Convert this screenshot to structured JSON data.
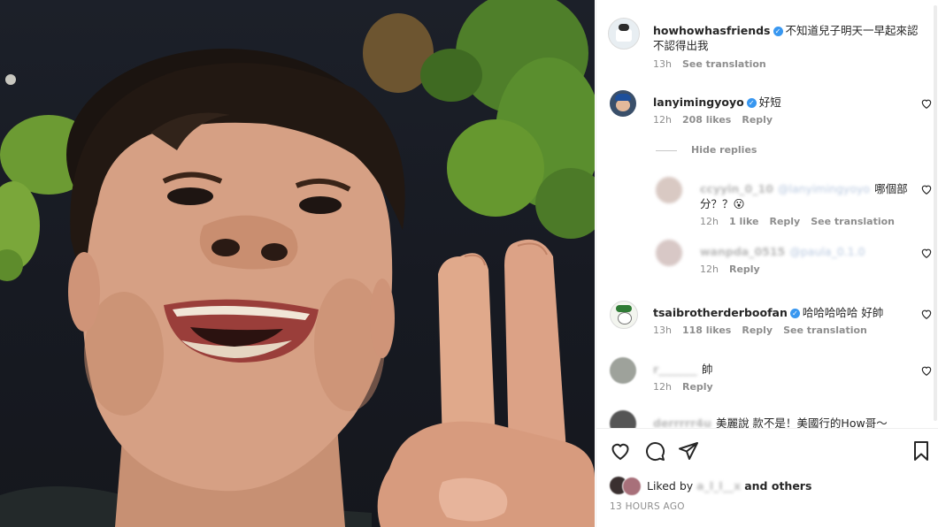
{
  "post": {
    "author": "howhowhasfriends",
    "caption_line1": "不知道兒子明天一早起來認",
    "caption_line2": "不認得出我",
    "time": "13h",
    "see_translation": "See translation"
  },
  "comments": [
    {
      "user": "lanyimingyoyo",
      "verified": true,
      "text": "好短",
      "time": "12h",
      "likes": "208 likes",
      "reply": "Reply"
    },
    {
      "user": "tsaibrotherderboofan",
      "verified": true,
      "text": "哈哈哈哈哈 好帥",
      "time": "13h",
      "likes": "118 likes",
      "reply": "Reply",
      "see_translation": "See translation"
    },
    {
      "user": "r_______",
      "text": "帥",
      "time": "12h",
      "reply": "Reply"
    },
    {
      "user": "derrrrr4u",
      "text": "美麗說 款不是！美國行的How哥～"
    }
  ],
  "hide_replies": "Hide replies",
  "replies": [
    {
      "user": "ccyyin_0_10",
      "mention": "@lanyimingyoyo",
      "text1": "哪個部",
      "text2": "分？？😮",
      "time": "12h",
      "likes": "1 like",
      "reply": "Reply",
      "see_translation": "See translation"
    },
    {
      "user": "wanpda_0515",
      "mention": "@paula_0.1.0",
      "time": "12h",
      "reply": "Reply"
    }
  ],
  "likes_summary": {
    "prefix": "Liked by",
    "user": "a_l_l__x",
    "suffix": "and others"
  },
  "timestamp": "13 HOURS AGO",
  "colors": {
    "verified": "#3897f0",
    "meta": "#8e8e8e",
    "text": "#262626"
  },
  "icons": [
    "heart-icon",
    "comment-icon",
    "share-icon",
    "bookmark-icon"
  ]
}
